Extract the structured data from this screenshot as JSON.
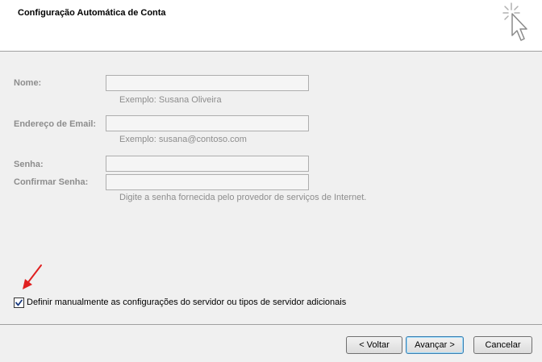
{
  "header": {
    "title": "Configuração Automática de Conta"
  },
  "form": {
    "name_label": "Nome:",
    "name_value": "",
    "name_hint": "Exemplo: Susana Oliveira",
    "email_label": "Endereço de Email:",
    "email_value": "",
    "email_hint": "Exemplo: susana@contoso.com",
    "password_label": "Senha:",
    "password_value": "",
    "confirm_label": "Confirmar Senha:",
    "confirm_value": "",
    "password_hint": "Digite a senha fornecida pelo provedor de serviços de Internet."
  },
  "manual": {
    "label": "Definir manualmente as configurações do servidor ou tipos de servidor adicionais",
    "checked": true
  },
  "buttons": {
    "back": "< Voltar",
    "next": "Avançar >",
    "cancel": "Cancelar"
  },
  "colors": {
    "annotation_arrow": "#e02020",
    "disabled_text": "#8d8d8d"
  }
}
